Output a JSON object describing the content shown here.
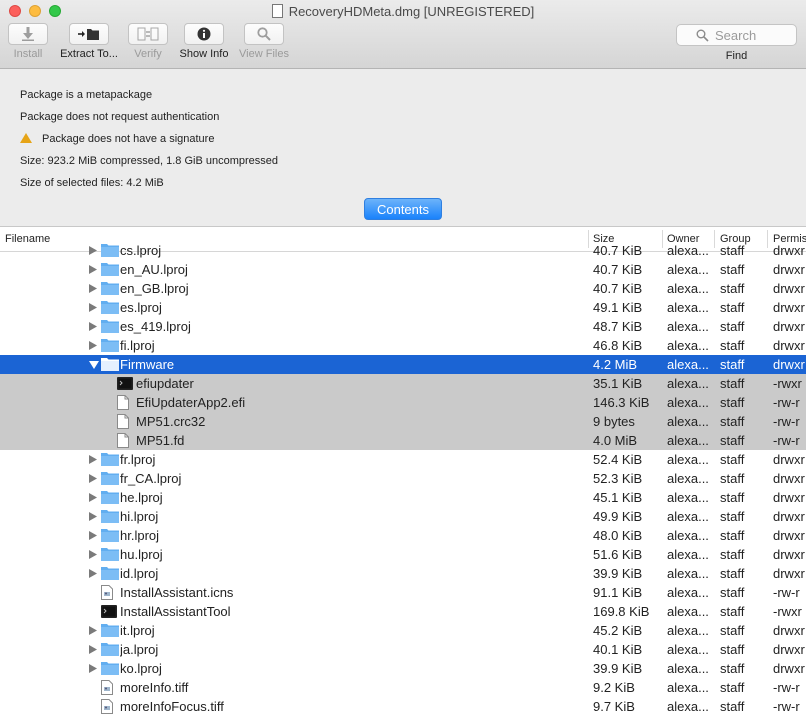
{
  "window": {
    "title": "RecoveryHDMeta.dmg [UNREGISTERED]"
  },
  "toolbar": {
    "install": "Install",
    "extract": "Extract To...",
    "verify": "Verify",
    "show_info": "Show Info",
    "view_files": "View Files",
    "search_placeholder": "Search",
    "find": "Find"
  },
  "info": {
    "line1": "Package is a metapackage",
    "line2": "Package does not request authentication",
    "line3": "Package does not have a signature",
    "line4": "Size: 923.2 MiB compressed, 1.8 GiB uncompressed",
    "line5": "Size of selected files: 4.2 MiB"
  },
  "contents_button": "Contents",
  "table": {
    "columns": {
      "filename": "Filename",
      "size": "Size",
      "owner": "Owner",
      "group": "Group",
      "permissions": "Permis"
    },
    "top_partial": {
      "name": "cs.lproj",
      "size": "40.7 KiB",
      "owner": "alexa...",
      "group": "staff",
      "perm": "drwxr"
    },
    "rows": [
      {
        "name": "en_AU.lproj",
        "size": "40.7 KiB",
        "owner": "alexa...",
        "group": "staff",
        "perm": "drwxr",
        "kind": "folder",
        "level": 0,
        "disclosure": "closed",
        "state": ""
      },
      {
        "name": "en_GB.lproj",
        "size": "40.7 KiB",
        "owner": "alexa...",
        "group": "staff",
        "perm": "drwxr",
        "kind": "folder",
        "level": 0,
        "disclosure": "closed",
        "state": ""
      },
      {
        "name": "es.lproj",
        "size": "49.1 KiB",
        "owner": "alexa...",
        "group": "staff",
        "perm": "drwxr",
        "kind": "folder",
        "level": 0,
        "disclosure": "closed",
        "state": ""
      },
      {
        "name": "es_419.lproj",
        "size": "48.7 KiB",
        "owner": "alexa...",
        "group": "staff",
        "perm": "drwxr",
        "kind": "folder",
        "level": 0,
        "disclosure": "closed",
        "state": ""
      },
      {
        "name": "fi.lproj",
        "size": "46.8 KiB",
        "owner": "alexa...",
        "group": "staff",
        "perm": "drwxr",
        "kind": "folder",
        "level": 0,
        "disclosure": "closed",
        "state": ""
      },
      {
        "name": "Firmware",
        "size": "4.2 MiB",
        "owner": "alexa...",
        "group": "staff",
        "perm": "drwxr",
        "kind": "folder",
        "level": 0,
        "disclosure": "open",
        "state": "selected"
      },
      {
        "name": "efiupdater",
        "size": "35.1 KiB",
        "owner": "alexa...",
        "group": "staff",
        "perm": "-rwxr",
        "kind": "exec",
        "level": 1,
        "disclosure": "none",
        "state": "child"
      },
      {
        "name": "EfiUpdaterApp2.efi",
        "size": "146.3 KiB",
        "owner": "alexa...",
        "group": "staff",
        "perm": "-rw-r",
        "kind": "doc",
        "level": 1,
        "disclosure": "none",
        "state": "child"
      },
      {
        "name": "MP51.crc32",
        "size": "9 bytes",
        "owner": "alexa...",
        "group": "staff",
        "perm": "-rw-r",
        "kind": "doc",
        "level": 1,
        "disclosure": "none",
        "state": "child"
      },
      {
        "name": "MP51.fd",
        "size": "4.0 MiB",
        "owner": "alexa...",
        "group": "staff",
        "perm": "-rw-r",
        "kind": "doc",
        "level": 1,
        "disclosure": "none",
        "state": "child"
      },
      {
        "name": "fr.lproj",
        "size": "52.4 KiB",
        "owner": "alexa...",
        "group": "staff",
        "perm": "drwxr",
        "kind": "folder",
        "level": 0,
        "disclosure": "closed",
        "state": ""
      },
      {
        "name": "fr_CA.lproj",
        "size": "52.3 KiB",
        "owner": "alexa...",
        "group": "staff",
        "perm": "drwxr",
        "kind": "folder",
        "level": 0,
        "disclosure": "closed",
        "state": ""
      },
      {
        "name": "he.lproj",
        "size": "45.1 KiB",
        "owner": "alexa...",
        "group": "staff",
        "perm": "drwxr",
        "kind": "folder",
        "level": 0,
        "disclosure": "closed",
        "state": ""
      },
      {
        "name": "hi.lproj",
        "size": "49.9 KiB",
        "owner": "alexa...",
        "group": "staff",
        "perm": "drwxr",
        "kind": "folder",
        "level": 0,
        "disclosure": "closed",
        "state": ""
      },
      {
        "name": "hr.lproj",
        "size": "48.0 KiB",
        "owner": "alexa...",
        "group": "staff",
        "perm": "drwxr",
        "kind": "folder",
        "level": 0,
        "disclosure": "closed",
        "state": ""
      },
      {
        "name": "hu.lproj",
        "size": "51.6 KiB",
        "owner": "alexa...",
        "group": "staff",
        "perm": "drwxr",
        "kind": "folder",
        "level": 0,
        "disclosure": "closed",
        "state": ""
      },
      {
        "name": "id.lproj",
        "size": "39.9 KiB",
        "owner": "alexa...",
        "group": "staff",
        "perm": "drwxr",
        "kind": "folder",
        "level": 0,
        "disclosure": "closed",
        "state": ""
      },
      {
        "name": "InstallAssistant.icns",
        "size": "91.1 KiB",
        "owner": "alexa...",
        "group": "staff",
        "perm": "-rw-r",
        "kind": "image",
        "level": 0,
        "disclosure": "none",
        "state": ""
      },
      {
        "name": "InstallAssistantTool",
        "size": "169.8 KiB",
        "owner": "alexa...",
        "group": "staff",
        "perm": "-rwxr",
        "kind": "exec",
        "level": 0,
        "disclosure": "none",
        "state": ""
      },
      {
        "name": "it.lproj",
        "size": "45.2 KiB",
        "owner": "alexa...",
        "group": "staff",
        "perm": "drwxr",
        "kind": "folder",
        "level": 0,
        "disclosure": "closed",
        "state": ""
      },
      {
        "name": "ja.lproj",
        "size": "40.1 KiB",
        "owner": "alexa...",
        "group": "staff",
        "perm": "drwxr",
        "kind": "folder",
        "level": 0,
        "disclosure": "closed",
        "state": ""
      },
      {
        "name": "ko.lproj",
        "size": "39.9 KiB",
        "owner": "alexa...",
        "group": "staff",
        "perm": "drwxr",
        "kind": "folder",
        "level": 0,
        "disclosure": "closed",
        "state": ""
      },
      {
        "name": "moreInfo.tiff",
        "size": "9.2 KiB",
        "owner": "alexa...",
        "group": "staff",
        "perm": "-rw-r",
        "kind": "image",
        "level": 0,
        "disclosure": "none",
        "state": ""
      },
      {
        "name": "moreInfoFocus.tiff",
        "size": "9.7 KiB",
        "owner": "alexa...",
        "group": "staff",
        "perm": "-rw-r",
        "kind": "image",
        "level": 0,
        "disclosure": "none",
        "state": ""
      }
    ]
  }
}
